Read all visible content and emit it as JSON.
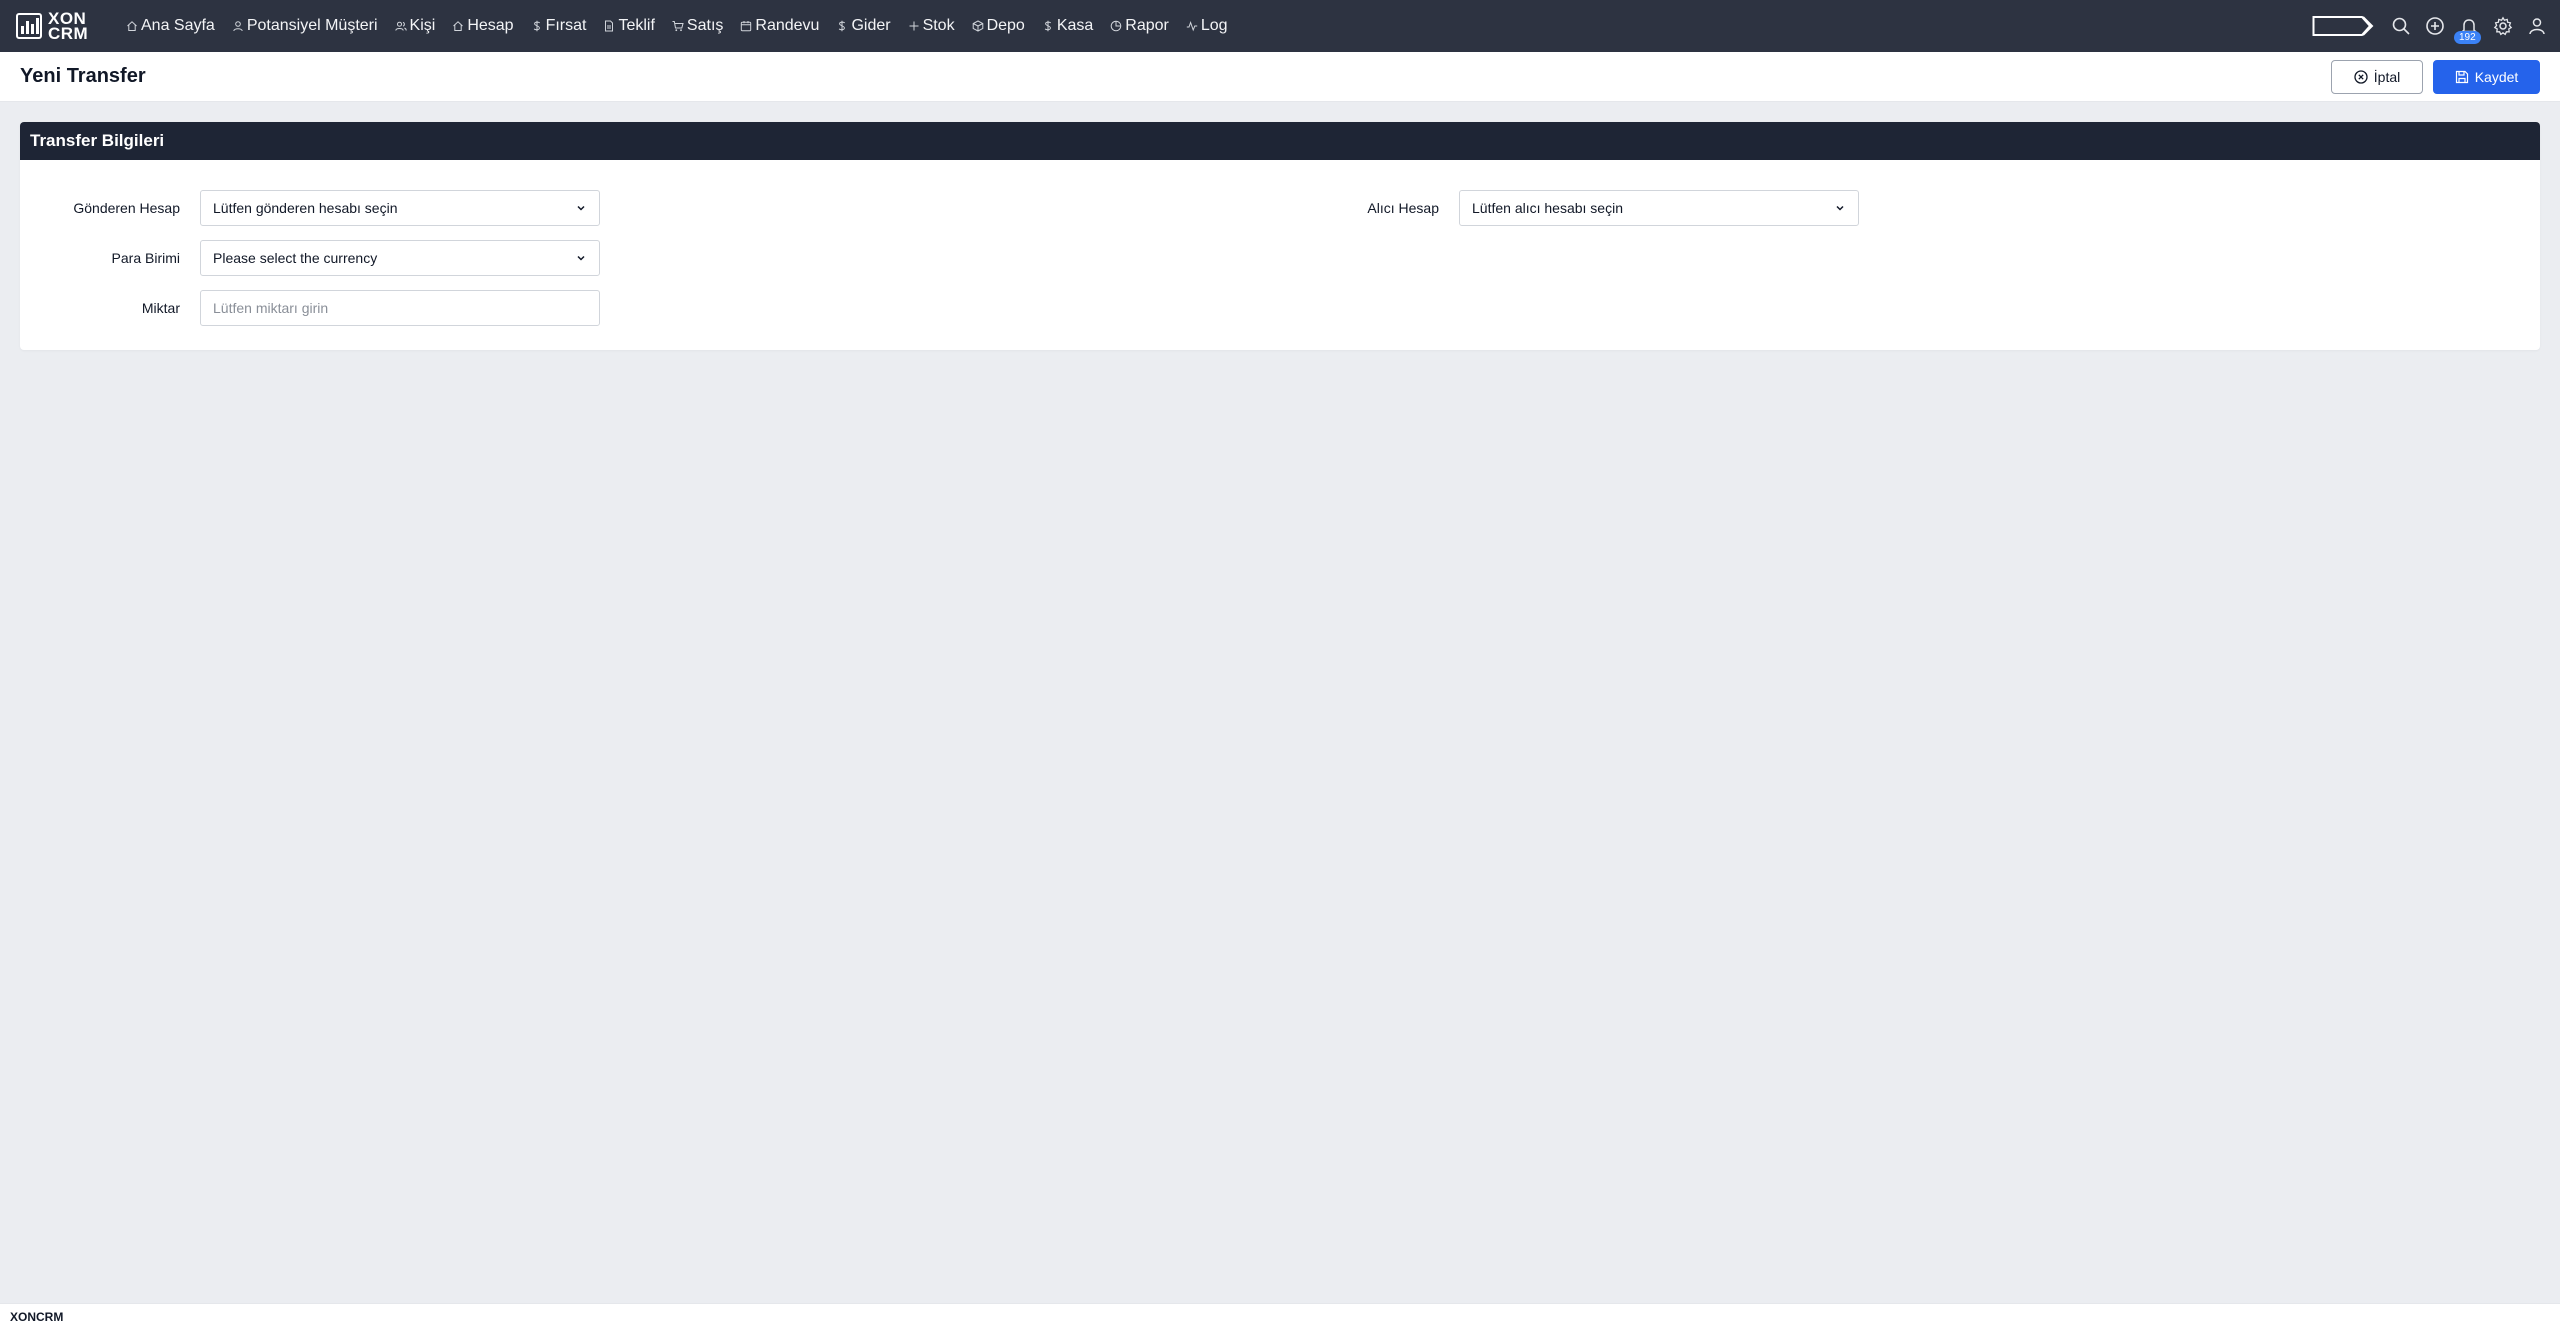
{
  "brand": {
    "line1": "XON",
    "line2": "CRM"
  },
  "nav": {
    "items": [
      {
        "label": "Ana Sayfa",
        "icon": "home-icon"
      },
      {
        "label": "Potansiyel Müşteri",
        "icon": "user-icon"
      },
      {
        "label": "Kişi",
        "icon": "users-icon"
      },
      {
        "label": "Hesap",
        "icon": "building-icon"
      },
      {
        "label": "Fırsat",
        "icon": "dollar-icon"
      },
      {
        "label": "Teklif",
        "icon": "document-icon"
      },
      {
        "label": "Satış",
        "icon": "cart-icon"
      },
      {
        "label": "Randevu",
        "icon": "calendar-icon"
      },
      {
        "label": "Gider",
        "icon": "dollar-icon"
      },
      {
        "label": "Stok",
        "icon": "plus-icon"
      },
      {
        "label": "Depo",
        "icon": "box-icon"
      },
      {
        "label": "Kasa",
        "icon": "dollar-icon"
      },
      {
        "label": "Rapor",
        "icon": "pie-chart-icon"
      },
      {
        "label": "Log",
        "icon": "activity-icon"
      }
    ],
    "notifications_count": "192"
  },
  "header": {
    "title": "Yeni Transfer",
    "cancel_label": "İptal",
    "save_label": "Kaydet"
  },
  "form": {
    "section_title": "Transfer Bilgileri",
    "sender_label": "Gönderen Hesap",
    "sender_value": "Lütfen gönderen hesabı seçin",
    "receiver_label": "Alıcı Hesap",
    "receiver_value": "Lütfen alıcı hesabı seçin",
    "currency_label": "Para Birimi",
    "currency_value": "Please select the currency",
    "amount_label": "Miktar",
    "amount_placeholder": "Lütfen miktarı girin"
  },
  "footer": {
    "text": "XONCRM"
  },
  "colors": {
    "nav_bg": "#2d3341",
    "section_header_bg": "#1e2535",
    "primary": "#2563eb",
    "badge": "#3b82f6"
  }
}
